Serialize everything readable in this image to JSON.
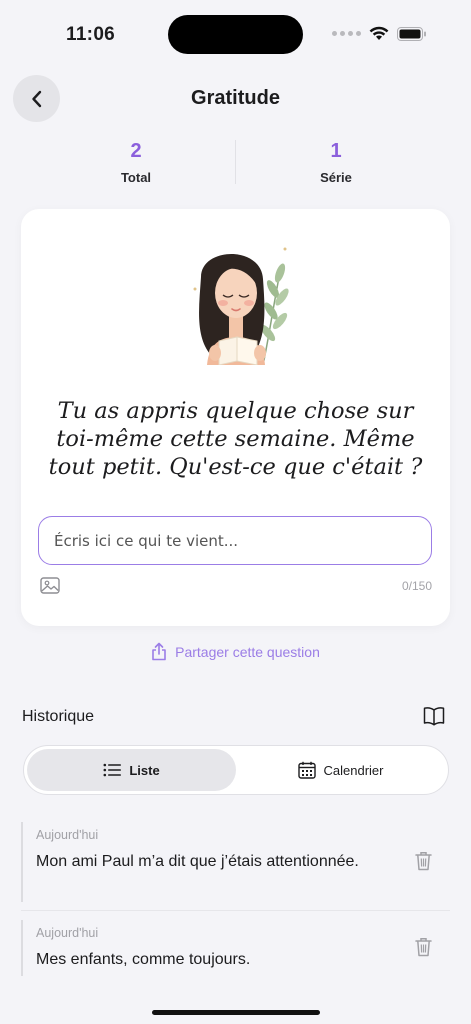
{
  "status_bar": {
    "time": "11:06"
  },
  "header": {
    "title": "Gratitude",
    "back_icon": "chevron-left-icon"
  },
  "stats": [
    {
      "value": "2",
      "label": "Total"
    },
    {
      "value": "1",
      "label": "Série"
    }
  ],
  "prompt": {
    "question": "Tu as appris quelque chose sur toi-même cette semaine. Même tout petit. Qu'est-ce que c'était ?",
    "input_placeholder": "Écris ici ce qui te vient...",
    "input_value": "",
    "counter": "0/150"
  },
  "share": {
    "label": "Partager cette question"
  },
  "history": {
    "title": "Historique",
    "tabs": [
      {
        "label": "Liste",
        "icon": "list-icon",
        "active": true
      },
      {
        "label": "Calendrier",
        "icon": "calendar-icon",
        "active": false
      }
    ],
    "entries": [
      {
        "date": "Aujourd'hui",
        "text": "Mon ami Paul m’a dit que j’étais attentionnée."
      },
      {
        "date": "Aujourd'hui",
        "text": "Mes enfants, comme toujours."
      }
    ]
  },
  "colors": {
    "accent": "#9b7de6",
    "stat_value": "#8b5fdc",
    "background": "#f4f4f8"
  }
}
